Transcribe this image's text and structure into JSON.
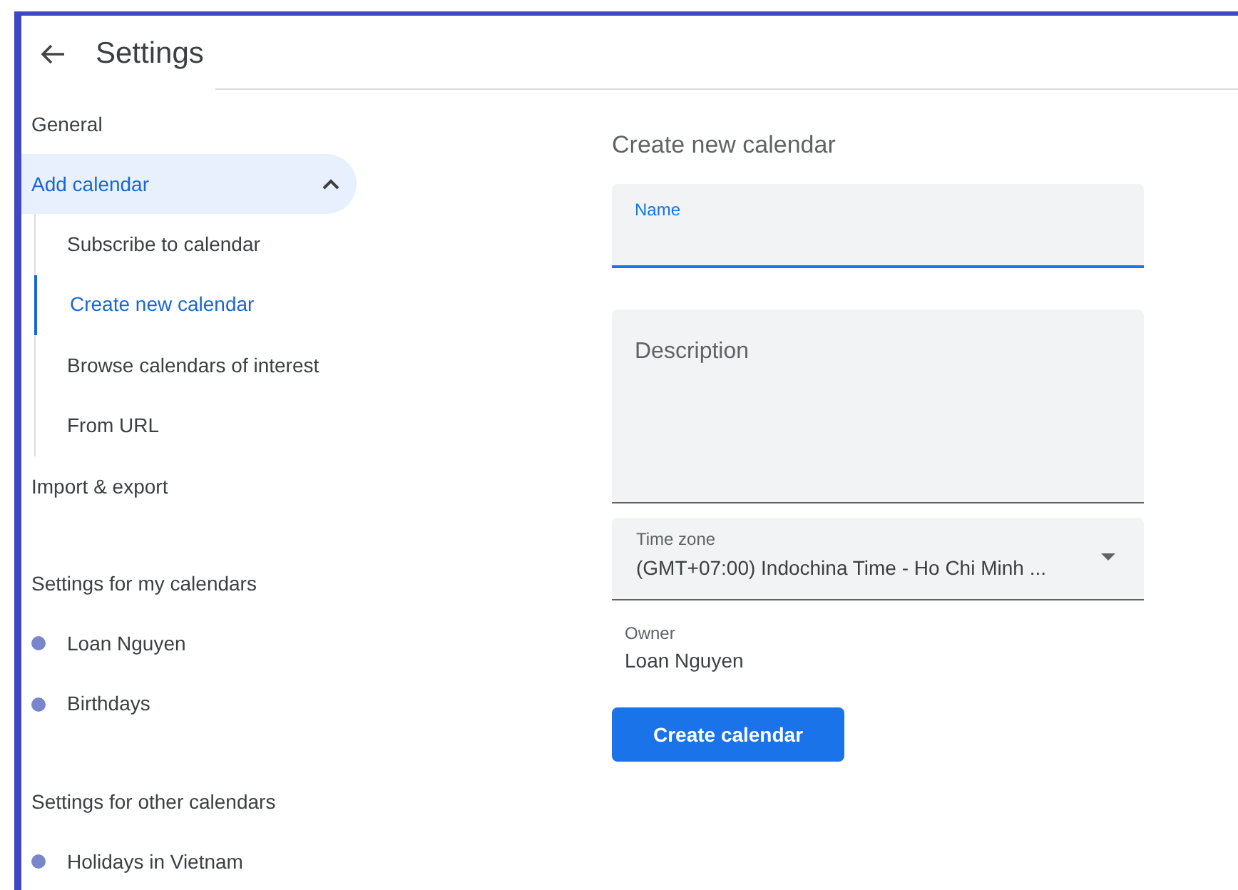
{
  "header": {
    "title": "Settings"
  },
  "sidebar": {
    "items": [
      {
        "kind": "link",
        "label": "General"
      },
      {
        "kind": "group",
        "label": "Add calendar",
        "expanded": true,
        "children": [
          {
            "label": "Subscribe to calendar",
            "selected": false
          },
          {
            "label": "Create new calendar",
            "selected": true
          },
          {
            "label": "Browse calendars of interest",
            "selected": false
          },
          {
            "label": "From URL",
            "selected": false
          }
        ]
      },
      {
        "kind": "link",
        "label": "Import & export"
      }
    ],
    "sections": [
      {
        "heading": "Settings for my calendars",
        "calendars": [
          {
            "name": "Loan Nguyen",
            "color": "#7986cb"
          },
          {
            "name": "Birthdays",
            "color": "#7986cb"
          }
        ]
      },
      {
        "heading": "Settings for other calendars",
        "calendars": [
          {
            "name": "Holidays in Vietnam",
            "color": "#7986cb"
          }
        ]
      }
    ]
  },
  "form": {
    "title": "Create new calendar",
    "fields": [
      {
        "kind": "text",
        "label": "Name",
        "focused": true
      },
      {
        "kind": "textarea",
        "placeholder": "Description",
        "focused": false
      },
      {
        "kind": "select",
        "label": "Time zone",
        "value": "(GMT+07:00) Indochina Time - Ho Chi Minh ...",
        "focused": false
      }
    ],
    "owner": {
      "label": "Owner",
      "value": "Loan Nguyen"
    },
    "button": "Create calendar"
  }
}
